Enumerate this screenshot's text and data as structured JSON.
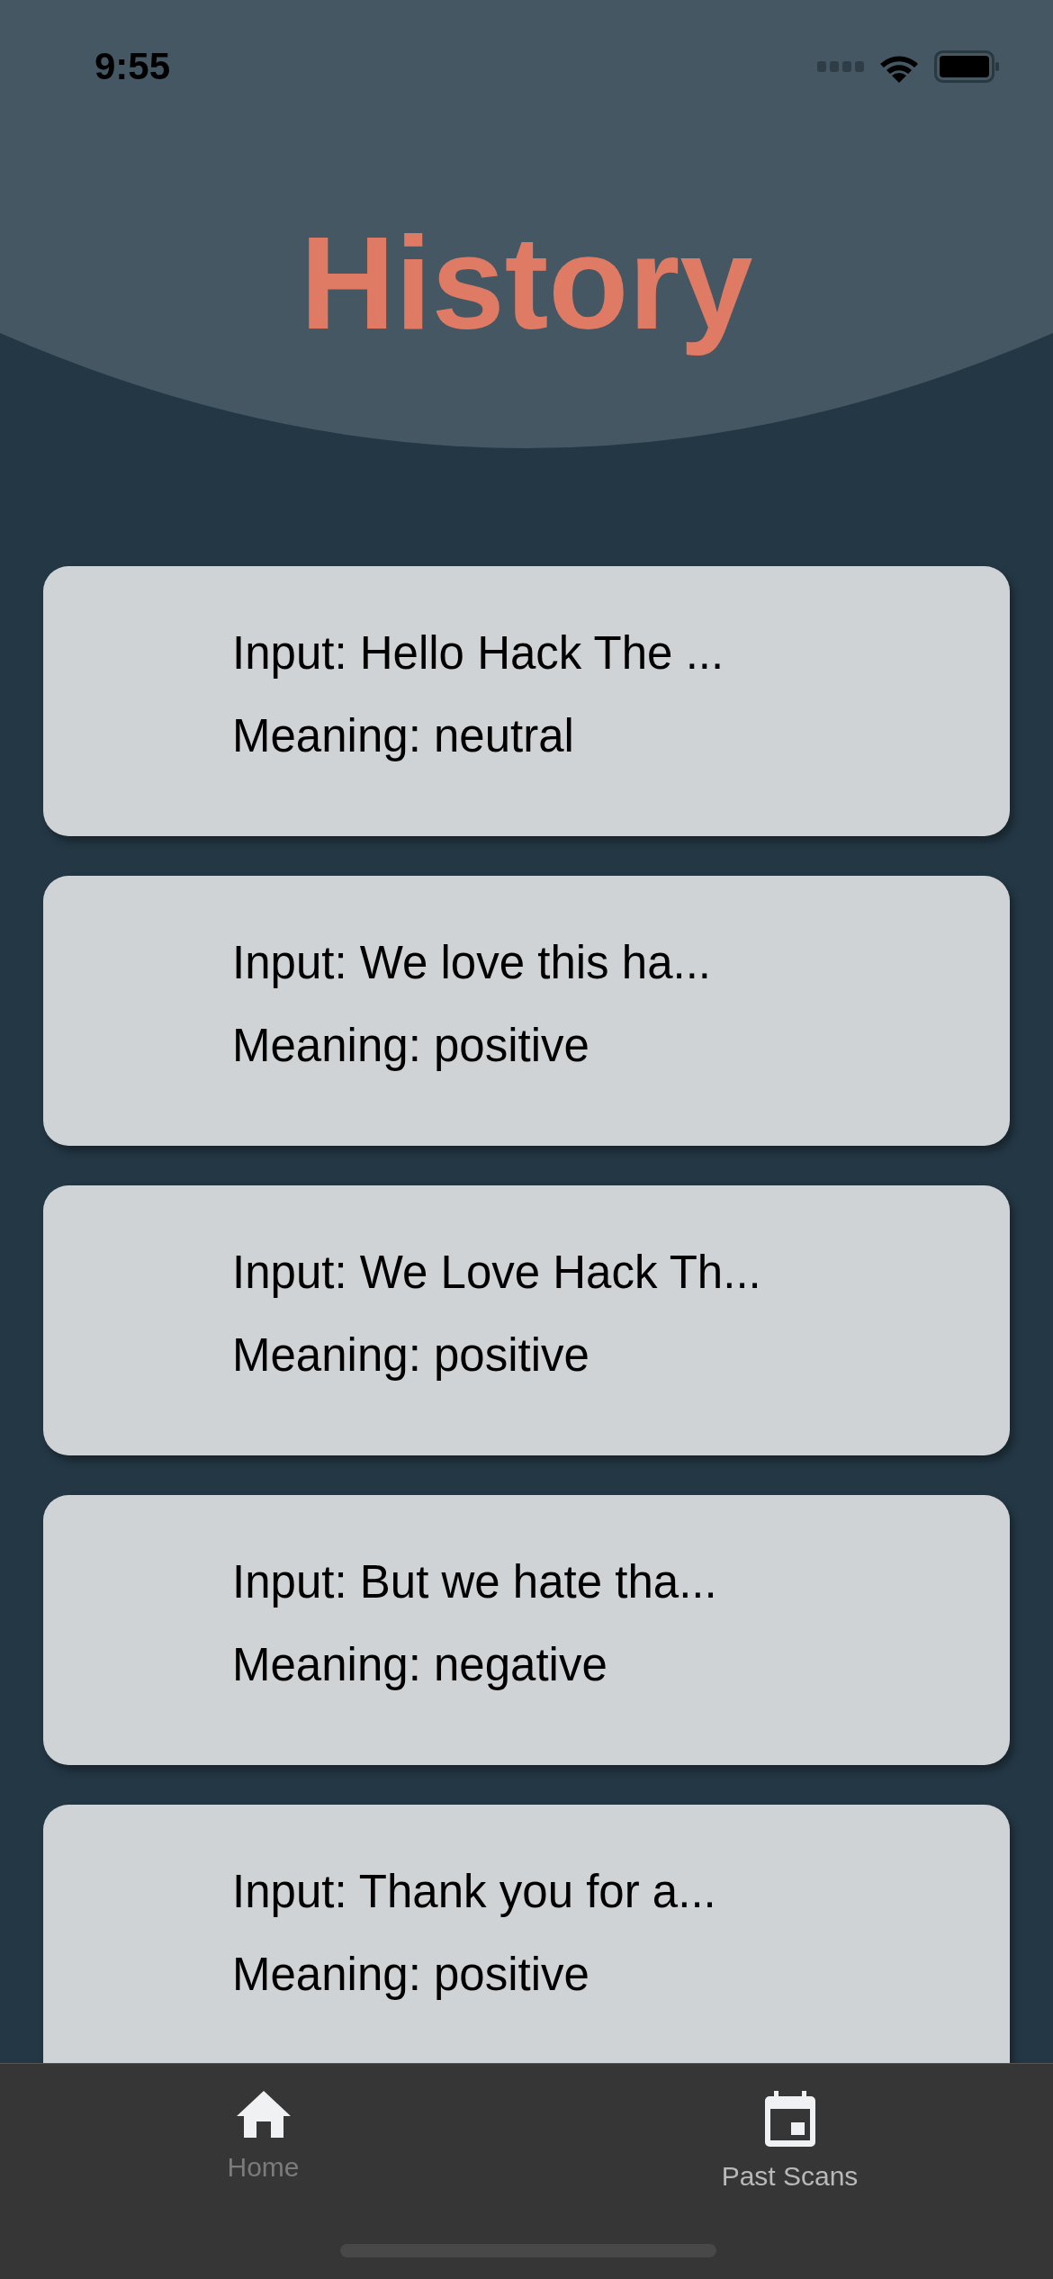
{
  "status_bar": {
    "time": "9:55"
  },
  "title": "History",
  "history": [
    {
      "input": "Input: Hello Hack The ...",
      "meaning": "Meaning: neutral"
    },
    {
      "input": "Input: We love this ha...",
      "meaning": "Meaning: positive"
    },
    {
      "input": "Input: We Love Hack Th...",
      "meaning": "Meaning: positive"
    },
    {
      "input": "Input: But we hate tha...",
      "meaning": "Meaning: negative"
    },
    {
      "input": "Input: Thank you for a...",
      "meaning": "Meaning: positive"
    }
  ],
  "tabs": [
    {
      "label": "Home",
      "selected": false
    },
    {
      "label": "Past Scans",
      "selected": true
    }
  ]
}
